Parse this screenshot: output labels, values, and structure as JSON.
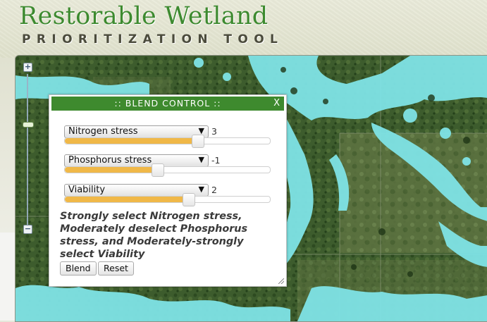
{
  "header": {
    "title": "Restorable Wetland",
    "subtitle": "PRIORITIZATION TOOL"
  },
  "map": {
    "zoom_in_label": "+",
    "zoom_out_label": "−",
    "zoom_level_fraction": 0.32,
    "colors": {
      "wetland": "#7fe3e6",
      "forest": "#2f4d22",
      "field": "#6b7d45"
    }
  },
  "blend_control": {
    "title": ":: BLEND CONTROL ::",
    "close_label": "X",
    "layers": [
      {
        "name": "Nitrogen stress",
        "weight": "3",
        "slider_fraction": 0.65
      },
      {
        "name": "Phosphorus stress",
        "weight": "-1",
        "slider_fraction": 0.455
      },
      {
        "name": "Viability",
        "weight": "2",
        "slider_fraction": 0.605
      }
    ],
    "arrow": "▼",
    "summary": "Strongly select Nitrogen stress, Moderately deselect Phosphorus stress, and Moderately-strongly select Viability",
    "blend_label": "Blend",
    "reset_label": "Reset"
  }
}
